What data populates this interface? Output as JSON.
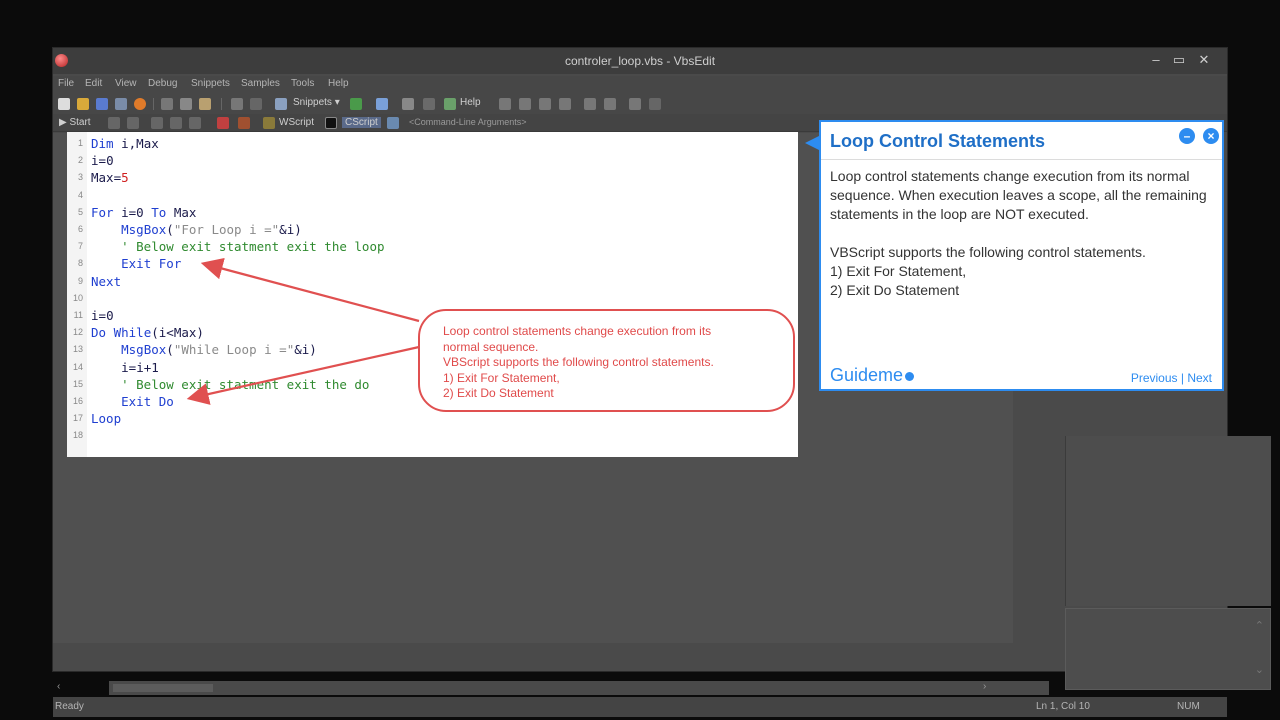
{
  "window": {
    "title": "controler_loop.vbs - VbsEdit",
    "controls": {
      "minimize": "–",
      "maximize": "▭",
      "close": "✕"
    }
  },
  "menu": [
    "File",
    "Edit",
    "View",
    "Debug",
    "Snippets",
    "Samples",
    "Tools",
    "Help"
  ],
  "toolbar1": {
    "snippets_label": "Snippets ▾",
    "help_label": "Help"
  },
  "toolbar2": {
    "start_label": "Start",
    "wscript_label": "WScript",
    "cscript_label": "CScript",
    "args_placeholder": "<Command-Line Arguments>"
  },
  "editor": {
    "lines": [
      {
        "n": "1",
        "code": "Dim i,Max"
      },
      {
        "n": "2",
        "code": "i=0"
      },
      {
        "n": "3",
        "code": "Max=5"
      },
      {
        "n": "4",
        "code": ""
      },
      {
        "n": "5",
        "code": "For i=0 To Max"
      },
      {
        "n": "6",
        "code": "    MsgBox(\"For Loop i =\"&i)"
      },
      {
        "n": "7",
        "code": "    ' Below exit statment exit the loop"
      },
      {
        "n": "8",
        "code": "    Exit For"
      },
      {
        "n": "9",
        "code": "Next"
      },
      {
        "n": "10",
        "code": ""
      },
      {
        "n": "11",
        "code": "i=0"
      },
      {
        "n": "12",
        "code": "Do While(i<Max)"
      },
      {
        "n": "13",
        "code": "    MsgBox(\"While Loop i =\"&i)"
      },
      {
        "n": "14",
        "code": "    i=i+1"
      },
      {
        "n": "15",
        "code": "    ' Below exit statment exit the do"
      },
      {
        "n": "16",
        "code": "    Exit Do"
      },
      {
        "n": "17",
        "code": "Loop"
      },
      {
        "n": "18",
        "code": ""
      }
    ]
  },
  "callout": {
    "lines": [
      "Loop control statements change execution from its",
      "normal sequence.",
      "VBScript supports the following control statements.",
      "1) Exit For Statement,",
      "2) Exit Do Statement"
    ],
    "color": "#e04a4a"
  },
  "guide": {
    "title": "Loop Control Statements",
    "paragraph1": "Loop control statements change execution from its normal sequence. When execution leaves a scope, all the remaining statements in the loop are NOT executed.",
    "paragraph2": "VBScript supports the following control statements.",
    "item1": "1) Exit For Statement,",
    "item2": "2) Exit Do Statement",
    "logo": "Guideme",
    "prev_label": "Previous",
    "separator": "|",
    "next_label": "Next",
    "accent": "#2d8cf0"
  },
  "status": {
    "left": "Ready",
    "position": "Ln 1, Col 10",
    "num": "NUM"
  }
}
